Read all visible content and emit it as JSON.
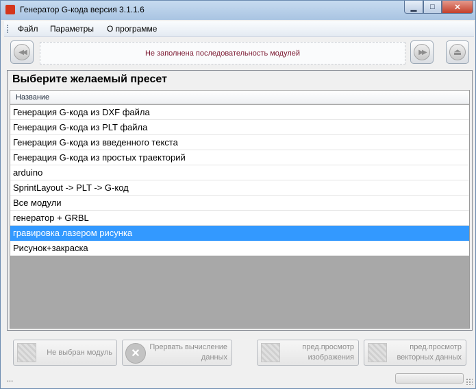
{
  "window": {
    "title": "Генератор G-кода версия 3.1.1.6",
    "min_glyph": "▁",
    "max_glyph": "□",
    "close_glyph": "✕"
  },
  "menu": {
    "items": [
      "Файл",
      "Параметры",
      "О программе"
    ]
  },
  "toolbar": {
    "status_message": "Не заполнена последовательность модулей",
    "prev_glyph": "◀◀",
    "next_glyph": "▶▶",
    "eject_glyph": "⏏"
  },
  "panel": {
    "title": "Выберите желаемый пресет",
    "column_header": "Название",
    "rows": [
      "Генерация G-кода из DXF файла",
      "Генерация G-кода из PLT файла",
      "Генерация G-кода из введенного текста",
      "Генерация G-кода из простых траекторий",
      "arduino",
      "SprintLayout -> PLT -> G-код",
      "Все модули",
      "генератор + GRBL",
      "гравировка лазером рисунка",
      "Рисунок+закраска"
    ],
    "selected_index": 8
  },
  "buttons": {
    "no_module": "Не выбран модуль",
    "stop_line1": "Прервать вычисление",
    "stop_line2": "данных",
    "preview_img_line1": "пред.просмотр",
    "preview_img_line2": "изображения",
    "preview_vec_line1": "пред.просмотр",
    "preview_vec_line2": "векторных данных",
    "stop_glyph": "✕"
  },
  "status": {
    "text": "..."
  },
  "colors": {
    "selection": "#3399ff",
    "status_message": "#7b1830",
    "empty_list_bg": "#a8a8a8"
  }
}
